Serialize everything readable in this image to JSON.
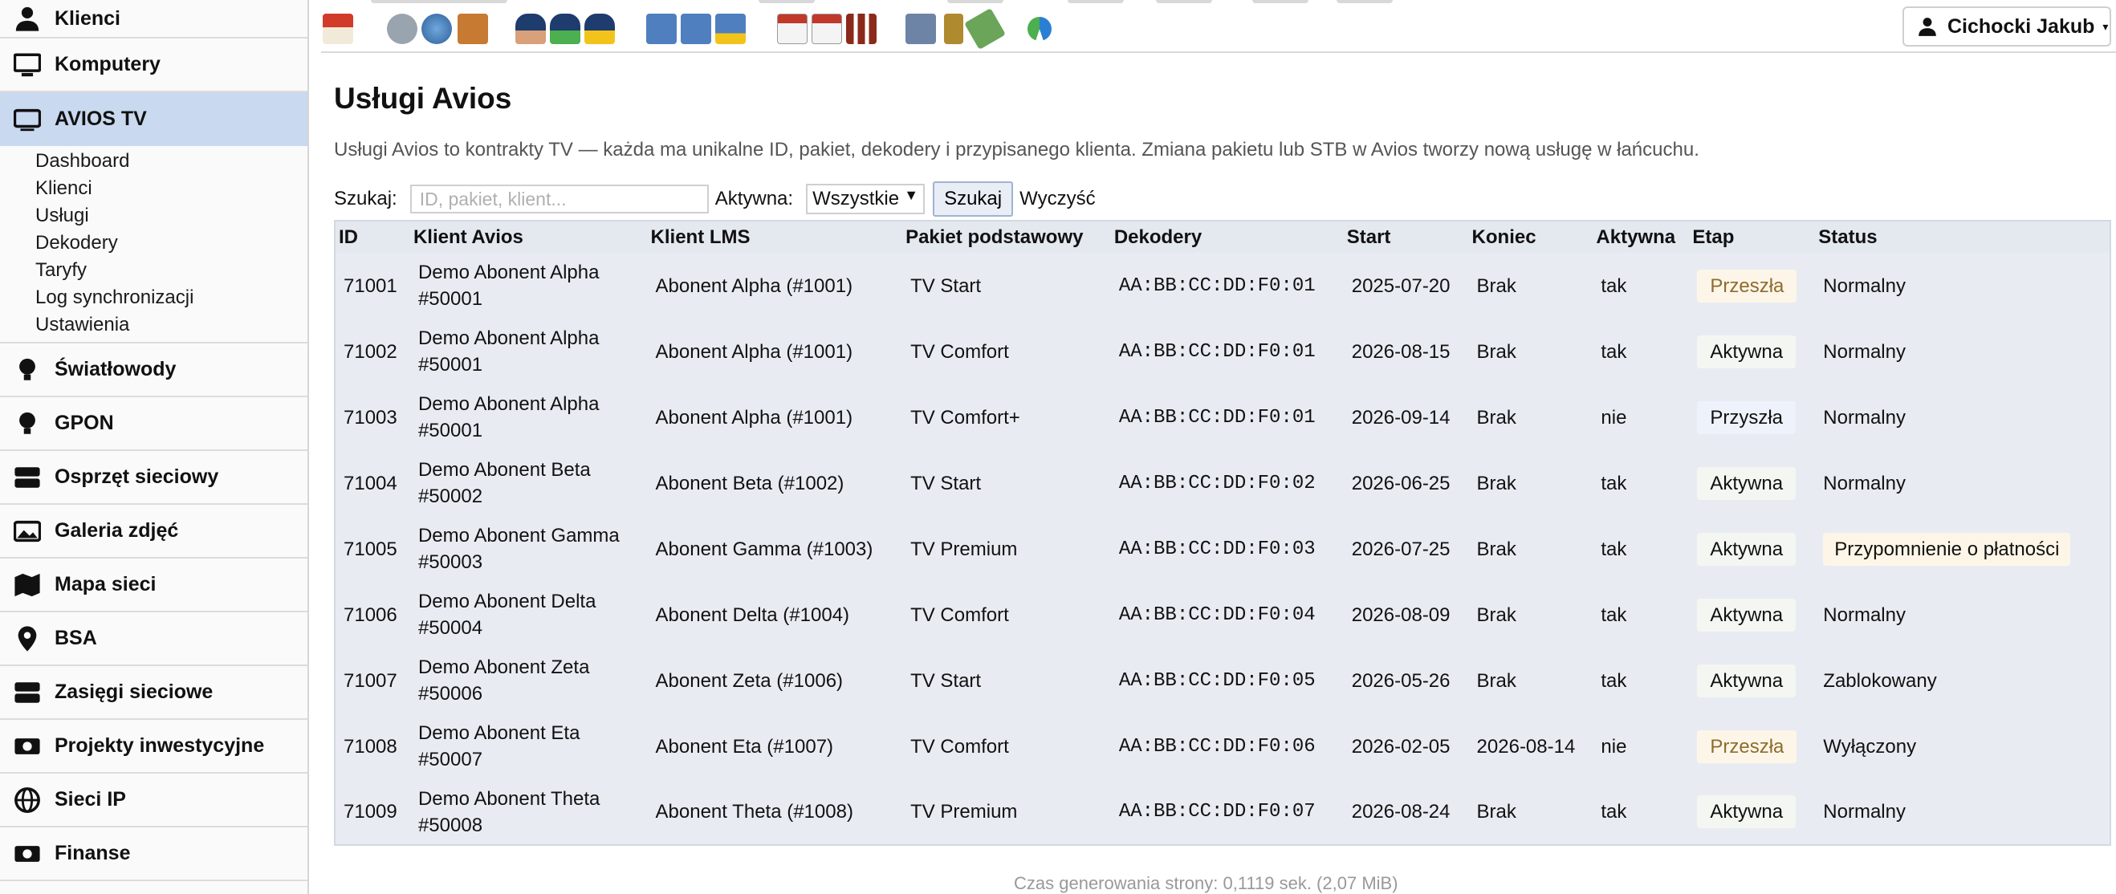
{
  "sidebar": {
    "items_top": [
      {
        "label": "Klienci",
        "icon": "user-icon"
      },
      {
        "label": "Komputery",
        "icon": "monitor-icon"
      },
      {
        "label": "AVIOS TV",
        "icon": "tv-icon"
      }
    ],
    "submenu": [
      "Dashboard",
      "Klienci",
      "Usługi",
      "Dekodery",
      "Taryfy",
      "Log synchronizacji",
      "Ustawienia"
    ],
    "items_bottom": [
      {
        "label": "Światłowody",
        "icon": "bulb-icon"
      },
      {
        "label": "GPON",
        "icon": "bulb-icon"
      },
      {
        "label": "Osprzęt sieciowy",
        "icon": "server-icon"
      },
      {
        "label": "Galeria zdjęć",
        "icon": "images-icon"
      },
      {
        "label": "Mapa sieci",
        "icon": "map-icon"
      },
      {
        "label": "BSA",
        "icon": "map-pin-icon"
      },
      {
        "label": "Zasięgi sieciowe",
        "icon": "server-icon"
      },
      {
        "label": "Projekty inwestycyjne",
        "icon": "money-icon"
      },
      {
        "label": "Sieci IP",
        "icon": "globe-icon"
      },
      {
        "label": "Finanse",
        "icon": "money-icon"
      }
    ]
  },
  "user_menu": {
    "name": "Cichocki Jakub",
    "caret": "▾"
  },
  "page": {
    "title": "Usługi Avios",
    "description": "Usługi Avios to kontrakty TV — każda ma unikalne ID, pakiet, dekodery i przypisanego klienta. Zmiana pakietu lub STB w Avios tworzy nową usługę w łańcuchu."
  },
  "search": {
    "label": "Szukaj:",
    "placeholder": "ID, pakiet, klient...",
    "value": "",
    "active_label": "Aktywna:",
    "active_value": "Wszystkie",
    "submit_label": "Szukaj",
    "clear_label": "Wyczyść"
  },
  "table": {
    "headers": [
      "ID",
      "Klient Avios",
      "Klient LMS",
      "Pakiet podstawowy",
      "Dekodery",
      "Start",
      "Koniec",
      "Aktywna",
      "Etap",
      "Status"
    ],
    "rows": [
      {
        "id": "71001",
        "avios_name": "Demo Abonent Alpha",
        "avios_id": "#50001",
        "lms": "Abonent Alpha (#1001)",
        "package": "TV Start",
        "decoder": "AA:BB:CC:DD:F0:01",
        "start": "2025-07-20",
        "end": "Brak",
        "active": "tak",
        "stage": "Przeszła",
        "stage_kind": "past",
        "status": "Normalny",
        "status_kind": "normal"
      },
      {
        "id": "71002",
        "avios_name": "Demo Abonent Alpha",
        "avios_id": "#50001",
        "lms": "Abonent Alpha (#1001)",
        "package": "TV Comfort",
        "decoder": "AA:BB:CC:DD:F0:01",
        "start": "2026-08-15",
        "end": "Brak",
        "active": "tak",
        "stage": "Aktywna",
        "stage_kind": "active",
        "status": "Normalny",
        "status_kind": "normal"
      },
      {
        "id": "71003",
        "avios_name": "Demo Abonent Alpha",
        "avios_id": "#50001",
        "lms": "Abonent Alpha (#1001)",
        "package": "TV Comfort+",
        "decoder": "AA:BB:CC:DD:F0:01",
        "start": "2026-09-14",
        "end": "Brak",
        "active": "nie",
        "stage": "Przyszła",
        "stage_kind": "future",
        "status": "Normalny",
        "status_kind": "normal"
      },
      {
        "id": "71004",
        "avios_name": "Demo Abonent Beta",
        "avios_id": "#50002",
        "lms": "Abonent Beta (#1002)",
        "package": "TV Start",
        "decoder": "AA:BB:CC:DD:F0:02",
        "start": "2026-06-25",
        "end": "Brak",
        "active": "tak",
        "stage": "Aktywna",
        "stage_kind": "active",
        "status": "Normalny",
        "status_kind": "normal"
      },
      {
        "id": "71005",
        "avios_name": "Demo Abonent Gamma",
        "avios_id": "#50003",
        "lms": "Abonent Gamma (#1003)",
        "package": "TV Premium",
        "decoder": "AA:BB:CC:DD:F0:03",
        "start": "2026-07-25",
        "end": "Brak",
        "active": "tak",
        "stage": "Aktywna",
        "stage_kind": "active",
        "status": "Przypomnienie o płatności",
        "status_kind": "warn"
      },
      {
        "id": "71006",
        "avios_name": "Demo Abonent Delta",
        "avios_id": "#50004",
        "lms": "Abonent Delta (#1004)",
        "package": "TV Comfort",
        "decoder": "AA:BB:CC:DD:F0:04",
        "start": "2026-08-09",
        "end": "Brak",
        "active": "tak",
        "stage": "Aktywna",
        "stage_kind": "active",
        "status": "Normalny",
        "status_kind": "normal"
      },
      {
        "id": "71007",
        "avios_name": "Demo Abonent Zeta",
        "avios_id": "#50006",
        "lms": "Abonent Zeta (#1006)",
        "package": "TV Start",
        "decoder": "AA:BB:CC:DD:F0:05",
        "start": "2026-05-26",
        "end": "Brak",
        "active": "tak",
        "stage": "Aktywna",
        "stage_kind": "active",
        "status": "Zablokowany",
        "status_kind": "normal"
      },
      {
        "id": "71008",
        "avios_name": "Demo Abonent Eta",
        "avios_id": "#50007",
        "lms": "Abonent Eta (#1007)",
        "package": "TV Comfort",
        "decoder": "AA:BB:CC:DD:F0:06",
        "start": "2026-02-05",
        "end": "2026-08-14",
        "active": "nie",
        "stage": "Przeszła",
        "stage_kind": "past",
        "status": "Wyłączony",
        "status_kind": "normal"
      },
      {
        "id": "71009",
        "avios_name": "Demo Abonent Theta",
        "avios_id": "#50008",
        "lms": "Abonent Theta (#1008)",
        "package": "TV Premium",
        "decoder": "AA:BB:CC:DD:F0:07",
        "start": "2026-08-24",
        "end": "Brak",
        "active": "tak",
        "stage": "Aktywna",
        "stage_kind": "active",
        "status": "Normalny",
        "status_kind": "normal"
      }
    ]
  },
  "toolbar_icons": [
    "home-icon",
    "add-network-icon",
    "globe-icon",
    "package-icon",
    "users-icon",
    "add-user-icon",
    "user-warning-icon",
    "computers-icon",
    "add-computer-icon",
    "computer-warning-icon",
    "calendar-icon",
    "add-calendar-icon",
    "stats-icon",
    "table-icon",
    "money-stack-icon",
    "cash-icon",
    "refresh-icon"
  ],
  "colors": {
    "accent": "#c9d9ef",
    "table_bg": "#e8ecf2",
    "past_stage_bg": "#fdf6e8"
  },
  "footer": "Czas generowania strony: 0,1119 sek. (2,07 MiB)"
}
